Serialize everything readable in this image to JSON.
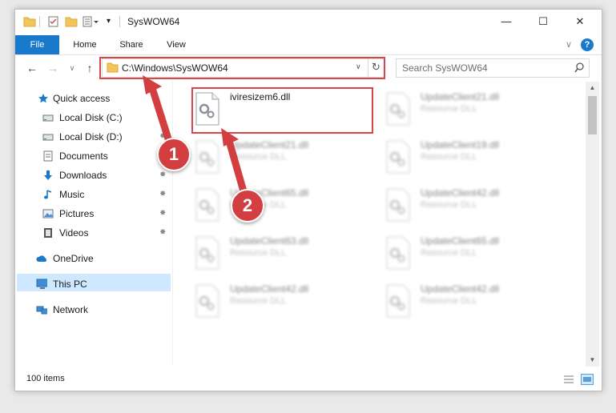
{
  "window": {
    "title": "SysWOW64",
    "controls": {
      "minimize": "—",
      "maximize": "☐",
      "close": "✕"
    }
  },
  "ribbon": {
    "tabs": [
      "File",
      "Home",
      "Share",
      "View"
    ],
    "collapse_glyph": "∨",
    "help_glyph": "?"
  },
  "navigation": {
    "back_glyph": "←",
    "forward_glyph": "→",
    "recent_glyph": "∨",
    "up_glyph": "↑",
    "address": "C:\\Windows\\SysWOW64",
    "refresh_glyph": "↻",
    "dropdown_glyph": "∨",
    "search_placeholder": "Search SysWOW64",
    "search_glyph": "⌕"
  },
  "sidebar": {
    "items": [
      {
        "label": "Quick access",
        "icon": "star-icon",
        "pinned": false
      },
      {
        "label": "Local Disk (C:)",
        "icon": "drive-icon",
        "pinned": true
      },
      {
        "label": "Local Disk (D:)",
        "icon": "drive-icon",
        "pinned": true
      },
      {
        "label": "Documents",
        "icon": "documents-icon",
        "pinned": true
      },
      {
        "label": "Downloads",
        "icon": "download-icon",
        "pinned": true
      },
      {
        "label": "Music",
        "icon": "music-icon",
        "pinned": true
      },
      {
        "label": "Pictures",
        "icon": "pictures-icon",
        "pinned": true
      },
      {
        "label": "Videos",
        "icon": "videos-icon",
        "pinned": true
      },
      {
        "label": "OneDrive",
        "icon": "cloud-icon",
        "pinned": false
      },
      {
        "label": "This PC",
        "icon": "computer-icon",
        "pinned": false,
        "selected": true
      },
      {
        "label": "Network",
        "icon": "network-icon",
        "pinned": false
      }
    ],
    "pin_glyph": "✸"
  },
  "files": [
    {
      "name": "iviresizem6.dll",
      "type": "",
      "highlighted": true
    },
    {
      "name": "UpdateClient21.dll",
      "type": "Resource DLL"
    },
    {
      "name": "UpdateClient21.dll",
      "type": "Resource DLL"
    },
    {
      "name": "UpdateClient19.dll",
      "type": "Resource DLL"
    },
    {
      "name": "UpdateClient65.dll",
      "type": "Resource DLL"
    },
    {
      "name": "UpdateClient42.dll",
      "type": "Resource DLL"
    },
    {
      "name": "UpdateClient63.dll",
      "type": "Resource DLL"
    },
    {
      "name": "UpdateClient65.dll",
      "type": "Resource DLL"
    },
    {
      "name": "UpdateClient42.dll",
      "type": "Resource DLL"
    },
    {
      "name": "UpdateClient42.dll",
      "type": "Resource DLL"
    }
  ],
  "status": {
    "item_count": "100 items"
  },
  "annotations": {
    "step1": "1",
    "step2": "2",
    "color": "#d33f40"
  },
  "colors": {
    "accent": "#1979ca",
    "selection": "#cde8ff",
    "highlight": "#d9464a"
  }
}
